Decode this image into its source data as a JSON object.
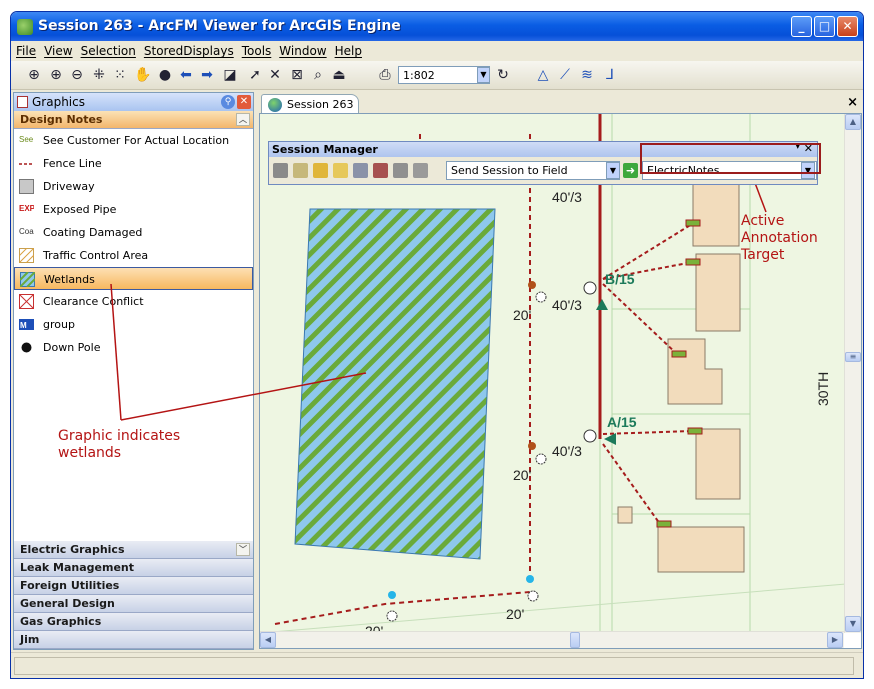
{
  "window": {
    "title": "Session 263 - ArcFM Viewer for ArcGIS Engine",
    "min": "_",
    "max": "□",
    "close": "✕"
  },
  "menu": [
    "File",
    "View",
    "Selection",
    "StoredDisplays",
    "Tools",
    "Window",
    "Help"
  ],
  "toolbar": {
    "scale": "1:802"
  },
  "graphics_panel": {
    "title": "Graphics",
    "active_group": "Design Notes",
    "items": [
      {
        "label": "See Customer For Actual Location",
        "symbol": "see-text-icon",
        "symbol_text": "See"
      },
      {
        "label": "Fence Line",
        "symbol": "dashed-line-icon"
      },
      {
        "label": "Driveway",
        "symbol": "gray-box-icon"
      },
      {
        "label": "Exposed Pipe",
        "symbol": "exp-text-icon",
        "symbol_text": "EXP"
      },
      {
        "label": "Coating Damaged",
        "symbol": "coa-text-icon",
        "symbol_text": "Coa"
      },
      {
        "label": "Traffic Control Area",
        "symbol": "hatch-orange-icon"
      },
      {
        "label": "Wetlands",
        "symbol": "hatch-green-icon",
        "selected": true
      },
      {
        "label": "Clearance Conflict",
        "symbol": "cross-hatch-red-icon"
      },
      {
        "label": "group",
        "symbol": "group-icon"
      },
      {
        "label": "Down Pole",
        "symbol": "black-dot-icon"
      }
    ],
    "groups": [
      "Electric Graphics",
      "Leak Management",
      "Foreign Utilities",
      "General Design",
      "Gas Graphics",
      "Jim"
    ]
  },
  "map_tab": {
    "label": "Session 263",
    "close": "×"
  },
  "session_manager": {
    "title": "Session Manager",
    "send_option": "Send Session to Field",
    "annotation_target": "ElectricNotes"
  },
  "map_labels": {
    "dims": [
      "40'/3",
      "40'/3",
      "40'/3",
      "20'",
      "20'",
      "20'",
      "20'"
    ],
    "features": [
      "B/15",
      "A/15"
    ],
    "street": "30TH"
  },
  "callouts": {
    "annotation_target": [
      "Active",
      "Annotation",
      "Target"
    ],
    "wetlands": [
      "Graphic indicates",
      "wetlands"
    ]
  },
  "colors": {
    "accent": "#0a5de4",
    "selected": "#f7b85f",
    "callout": "#b41414",
    "map_bg": "#eef6e2",
    "wetland_blue": "#8ec8ec",
    "wetland_green": "#6aaa3a",
    "electric_line": "#a51c1c",
    "building": "#f2dcbc"
  }
}
